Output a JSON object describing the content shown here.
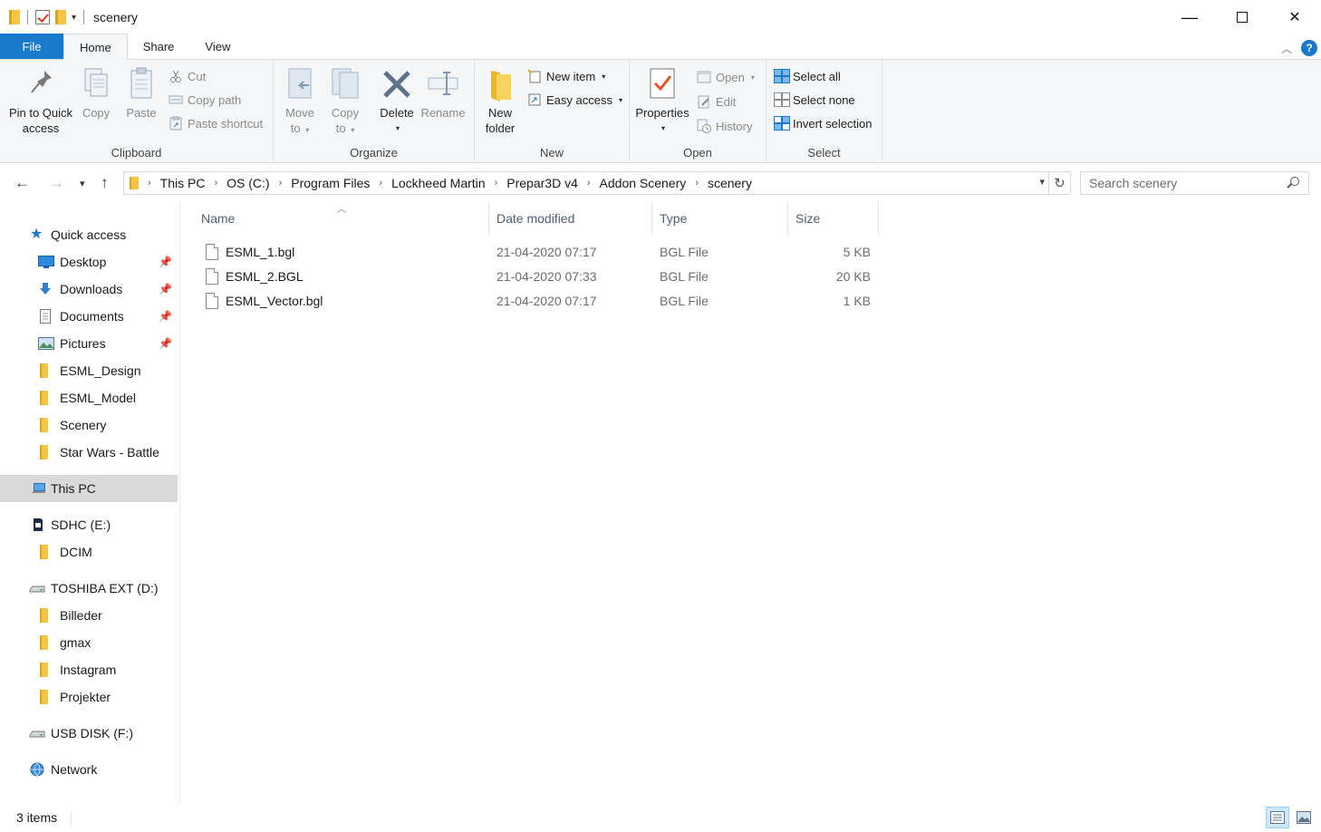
{
  "window": {
    "title": "scenery",
    "minimize_glyph": "—",
    "close_glyph": "✕"
  },
  "tabs": [
    {
      "label": "File"
    },
    {
      "label": "Home"
    },
    {
      "label": "Share"
    },
    {
      "label": "View"
    }
  ],
  "ribbon": {
    "clipboard": {
      "label": "Clipboard",
      "pin_label_1": "Pin to Quick",
      "pin_label_2": "access",
      "copy": "Copy",
      "paste": "Paste",
      "cut": "Cut",
      "copy_path": "Copy path",
      "paste_shortcut": "Paste shortcut"
    },
    "organize": {
      "label": "Organize",
      "move_1": "Move",
      "move_2": "to",
      "copy_1": "Copy",
      "copy_2": "to",
      "delete": "Delete",
      "rename": "Rename"
    },
    "new": {
      "label": "New",
      "new_folder_1": "New",
      "new_folder_2": "folder",
      "new_item": "New item",
      "easy_access": "Easy access"
    },
    "open": {
      "label": "Open",
      "properties": "Properties",
      "open": "Open",
      "edit": "Edit",
      "history": "History"
    },
    "select": {
      "label": "Select",
      "select_all": "Select all",
      "select_none": "Select none",
      "invert_selection": "Invert selection"
    }
  },
  "address": {
    "crumbs": [
      "This PC",
      "OS (C:)",
      "Program Files",
      "Lockheed Martin",
      "Prepar3D v4",
      "Addon Scenery",
      "scenery"
    ],
    "search_placeholder": "Search scenery"
  },
  "nav": {
    "quick_access": "Quick access",
    "pinned": [
      "Desktop",
      "Downloads",
      "Documents",
      "Pictures"
    ],
    "recent": [
      "ESML_Design",
      "ESML_Model",
      "Scenery",
      "Star Wars - Battle"
    ],
    "this_pc": "This PC",
    "sdhc": "SDHC (E:)",
    "sdhc_children": [
      "DCIM"
    ],
    "toshiba": "TOSHIBA EXT (D:)",
    "toshiba_children": [
      "Billeder",
      "gmax",
      "Instagram",
      "Projekter"
    ],
    "usb": "USB DISK (F:)",
    "network": "Network"
  },
  "columns": {
    "name": "Name",
    "date": "Date modified",
    "type": "Type",
    "size": "Size"
  },
  "files": [
    {
      "name": "ESML_1.bgl",
      "date": "21-04-2020 07:17",
      "type": "BGL File",
      "size": "5 KB"
    },
    {
      "name": "ESML_2.BGL",
      "date": "21-04-2020 07:33",
      "type": "BGL File",
      "size": "20 KB"
    },
    {
      "name": "ESML_Vector.bgl",
      "date": "21-04-2020 07:17",
      "type": "BGL File",
      "size": "1 KB"
    }
  ],
  "status": {
    "item_count": "3 items"
  },
  "colors": {
    "accent": "#1979ca",
    "folder": "#f6c543",
    "selected_nav": "#d9d9d9"
  }
}
